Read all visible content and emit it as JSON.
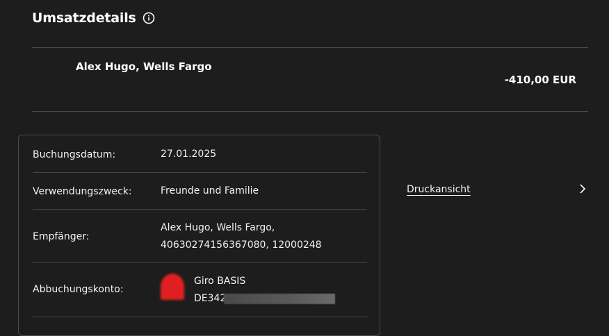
{
  "header": {
    "title": "Umsatzdetails",
    "info_icon": "info-circle-icon"
  },
  "transaction": {
    "payee": "Alex Hugo, Wells Fargo",
    "amount": "-410,00 EUR"
  },
  "details": {
    "booking_date_label": "Buchungsdatum:",
    "booking_date_value": "27.01.2025",
    "purpose_label": "Verwendungszweck:",
    "purpose_value": "Freunde und Familie",
    "recipient_label": "Empfänger:",
    "recipient_line1": "Alex Hugo, Wells Fargo,",
    "recipient_line2": "40630274156367080, 12000248",
    "debit_account_label": "Abbuchungskonto:",
    "account_name": "Giro BASIS",
    "account_iban_visible": "DE342"
  },
  "actions": {
    "print_view_label": "Druckansicht",
    "chevron_icon": "chevron-right-icon"
  },
  "colors": {
    "background": "#1d1d1d",
    "text": "#ffffff",
    "divider": "#4a4a4a",
    "account_logo": "#e02020"
  }
}
